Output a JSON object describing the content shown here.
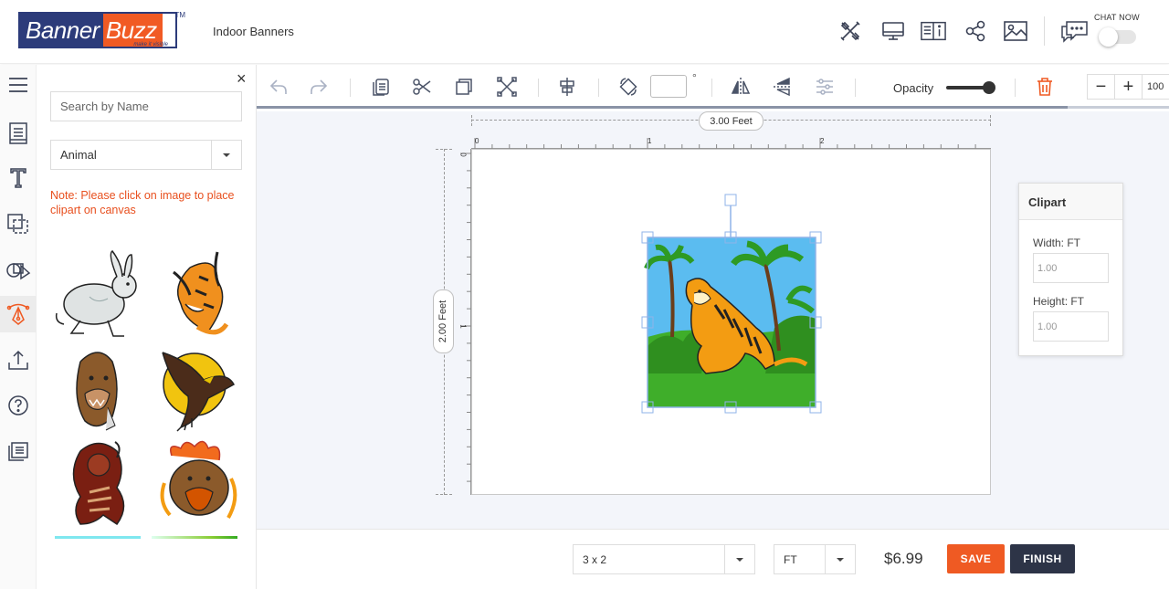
{
  "header": {
    "logo_part1": "Banner",
    "logo_part2": "Buzz",
    "logo_tagline": "make it visible",
    "logo_tm": "TM",
    "page_title": "Indoor Banners",
    "chat_label": "CHAT NOW",
    "icons": [
      "design-tools-icon",
      "desktop-preview-icon",
      "info-book-icon",
      "share-icon",
      "image-icon",
      "chat-icon"
    ]
  },
  "left_nav": {
    "items": [
      "menu-icon",
      "template-icon",
      "text-icon",
      "layers-icon",
      "shapes-icon",
      "clipart-icon",
      "upload-icon",
      "help-icon",
      "notes-icon"
    ],
    "active": "clipart-icon"
  },
  "panel": {
    "close_symbol": "×",
    "search_placeholder": "Search by Name",
    "category": "Animal",
    "note": "Note: Please click on image to place clipart on canvas",
    "clipart_names": [
      "rabbit",
      "tiger-tribal",
      "bear-head",
      "eagle-moon",
      "lion-warrior",
      "bear-fire"
    ]
  },
  "toolbar": {
    "rotation_value": "",
    "degree_symbol": "°",
    "opacity_label": "Opacity",
    "opacity_value": 100,
    "zoom_minus": "−",
    "zoom_plus": "+",
    "zoom_value": "100"
  },
  "canvas": {
    "width_label": "3.00 Feet",
    "height_label": "2.00 Feet",
    "ruler_h": [
      "0",
      "1",
      "2"
    ],
    "ruler_v": [
      "0",
      "1"
    ]
  },
  "clipart_props": {
    "title": "Clipart",
    "width_label": "Width: FT",
    "width_value": "1.00",
    "height_label": "Height: FT",
    "height_value": "1.00"
  },
  "footer": {
    "size": "3 x 2",
    "unit": "FT",
    "price": "$6.99",
    "save_label": "SAVE",
    "finish_label": "FINISH"
  },
  "colors": {
    "brand_blue": "#2c3b7a",
    "brand_orange": "#f15a24",
    "accent_orange": "#ef5a23",
    "dark_button": "#2d3447"
  }
}
